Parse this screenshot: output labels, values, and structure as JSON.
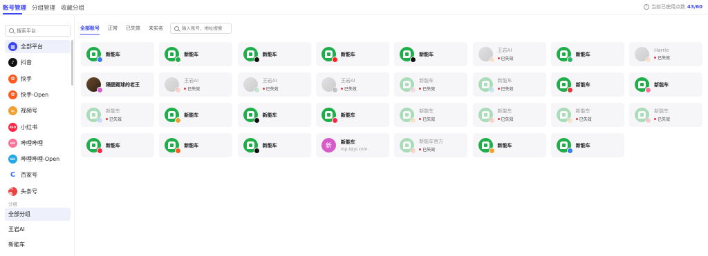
{
  "top_tabs": [
    "账号管理",
    "分组管理",
    "收藏分组"
  ],
  "usage": {
    "label": "当前已使用点数",
    "count": "43/60"
  },
  "sidebar": {
    "search_placeholder": "搜索平台",
    "platforms": [
      {
        "label": "全部平台",
        "icon": "grid-icon",
        "color": "#3b47f0",
        "glyph": "▦"
      },
      {
        "label": "抖音",
        "icon": "douyin-icon",
        "color": "#111111",
        "glyph": "♪"
      },
      {
        "label": "快手",
        "icon": "kuaishou-icon",
        "color": "#ff5a1f",
        "glyph": "✿"
      },
      {
        "label": "快手-Open",
        "icon": "kuaishou-open-icon",
        "color": "#ff5a1f",
        "glyph": "✿"
      },
      {
        "label": "视频号",
        "icon": "channels-icon",
        "color": "#f0a030",
        "glyph": "∞"
      },
      {
        "label": "小红书",
        "icon": "xiaohongshu-icon",
        "color": "#ff2442",
        "glyph": "RED"
      },
      {
        "label": "哔哩哔哩",
        "icon": "bilibili-icon",
        "color": "#fb7299",
        "glyph": "bili"
      },
      {
        "label": "哔哩哔哩-Open",
        "icon": "bilibili-open-icon",
        "color": "#23a7e8",
        "glyph": "bili"
      },
      {
        "label": "百家号",
        "icon": "baijiahao-icon",
        "color": "#2f6bff",
        "glyph": "C"
      },
      {
        "label": "头条号",
        "icon": "toutiao-icon",
        "color": "#f04142",
        "glyph": "头条"
      }
    ],
    "group_section_label": "分组",
    "groups": [
      "全部分组",
      "王岩AI",
      "新能车"
    ]
  },
  "filter_tabs": [
    "全部账号",
    "正常",
    "已失效",
    "未实名"
  ],
  "account_search_placeholder": "输入账号、地址搜索",
  "invalid_label": "已失效",
  "accounts": [
    {
      "name": "新能车",
      "avatar": "green",
      "badge": "#3a7bf0",
      "invalid": false
    },
    {
      "name": "新能车",
      "avatar": "green",
      "badge": "#1fae4a",
      "invalid": false
    },
    {
      "name": "新能车",
      "avatar": "green",
      "badge": "#111111",
      "invalid": false
    },
    {
      "name": "新能车",
      "avatar": "green",
      "badge": "#ff2020",
      "invalid": false
    },
    {
      "name": "新能车",
      "avatar": "green",
      "badge": "#111111",
      "invalid": false
    },
    {
      "name": "王岩AI",
      "avatar": "photo",
      "badge": "#f0a030",
      "invalid": true
    },
    {
      "name": "新能车",
      "avatar": "green",
      "badge": "#2fb36a",
      "invalid": false
    },
    {
      "name": "Harrie",
      "avatar": "photo",
      "badge": "#f0a030",
      "invalid": true
    },
    {
      "name": "隔壁踢球的老王",
      "avatar": "dark",
      "badge": "#d65ac8",
      "invalid": false
    },
    {
      "name": "王岩AI",
      "avatar": "photo",
      "badge": "#ff5a1f",
      "invalid": true
    },
    {
      "name": "王岩AI",
      "avatar": "photo",
      "badge": "#1fae4a",
      "invalid": true
    },
    {
      "name": "王岩AI",
      "avatar": "photo",
      "badge": "#111111",
      "invalid": true
    },
    {
      "name": "新能车",
      "avatar": "green",
      "badge": "#fb7299",
      "invalid": true
    },
    {
      "name": "新能车",
      "avatar": "green",
      "badge": "#23a7e8",
      "invalid": true
    },
    {
      "name": "新能车",
      "avatar": "green",
      "badge": "#e23a3a",
      "invalid": false
    },
    {
      "name": "新能车",
      "avatar": "green",
      "badge": "#fb7299",
      "invalid": false
    },
    {
      "name": "新能车",
      "avatar": "green",
      "badge": "#2f6bff",
      "invalid": true
    },
    {
      "name": "新能车",
      "avatar": "green",
      "badge": "#f0a030",
      "invalid": false
    },
    {
      "name": "新能车",
      "avatar": "green",
      "badge": "#111111",
      "invalid": false
    },
    {
      "name": "新能车",
      "avatar": "green",
      "badge": "#ff2442",
      "invalid": false
    },
    {
      "name": "新能车",
      "avatar": "green",
      "badge": "#f0a030",
      "invalid": true
    },
    {
      "name": "新能车",
      "avatar": "green",
      "badge": "#ff5a1f",
      "invalid": true
    },
    {
      "name": "新能车",
      "avatar": "green",
      "badge": "#f0a030",
      "invalid": true
    },
    {
      "name": "新能车",
      "avatar": "green",
      "badge": "#ff2442",
      "invalid": true
    },
    {
      "name": "新能车",
      "avatar": "green",
      "badge": "#ff2442",
      "invalid": false
    },
    {
      "name": "新能车",
      "avatar": "green",
      "badge": "#ff5a1f",
      "invalid": false
    },
    {
      "name": "新能车",
      "avatar": "green",
      "badge": "#111111",
      "invalid": false
    },
    {
      "name": "新能车",
      "avatar": "pink",
      "glyph": "新",
      "sub": "mp.iqiyi.com",
      "invalid": false
    },
    {
      "name": "新能车官方",
      "avatar": "green",
      "badge": "#ff5a1f",
      "invalid": true
    },
    {
      "name": "新能车",
      "avatar": "green",
      "badge": "#f0a030",
      "invalid": false
    },
    {
      "name": "新能车",
      "avatar": "green",
      "badge": "#3a7bf0",
      "invalid": false
    }
  ]
}
